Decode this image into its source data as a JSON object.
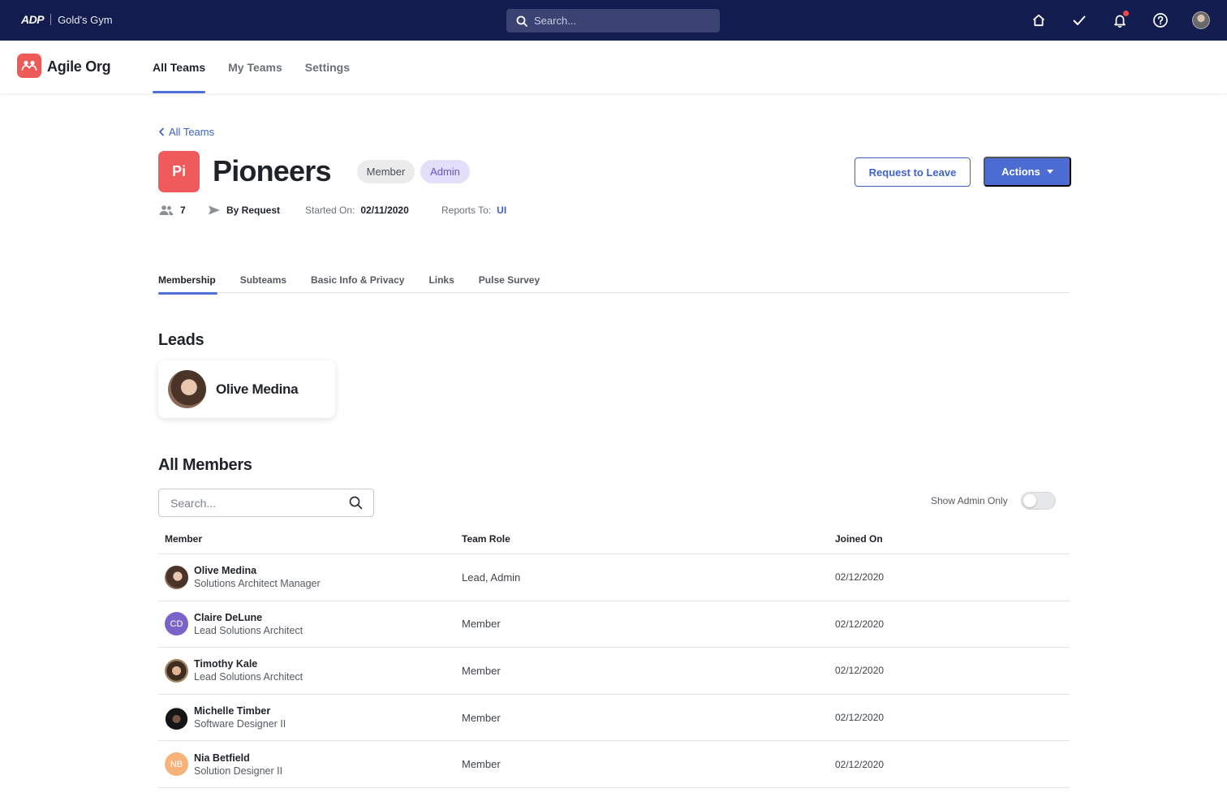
{
  "topbar": {
    "logo_text": "ADP",
    "company": "Gold's Gym",
    "search_placeholder": "Search...",
    "icons": [
      "home-icon",
      "check-icon",
      "bell-icon",
      "help-icon",
      "user-avatar"
    ]
  },
  "app": {
    "title": "Agile Org",
    "nav": [
      "All Teams",
      "My Teams",
      "Settings"
    ],
    "active_nav": "All Teams"
  },
  "team": {
    "breadcrumb": "All Teams",
    "initials": "Pi",
    "name": "Pioneers",
    "chips": [
      "Member",
      "Admin"
    ],
    "buttons": {
      "leave": "Request to Leave",
      "actions": "Actions"
    },
    "member_count": "7",
    "join_policy": "By Request",
    "started_label": "Started On:",
    "started_value": "02/11/2020",
    "reports_label": "Reports To:",
    "reports_value": "UI"
  },
  "tabs": [
    "Membership",
    "Subteams",
    "Basic Info & Privacy",
    "Links",
    "Pulse Survey"
  ],
  "active_tab": "Membership",
  "leads": {
    "heading": "Leads",
    "items": [
      {
        "name": "Olive Medina"
      }
    ]
  },
  "members": {
    "heading": "All Members",
    "search_placeholder": "Search...",
    "toggle_label": "Show Admin Only",
    "toggle_on": false,
    "columns": [
      "Member",
      "Team Role",
      "Joined On"
    ],
    "rows": [
      {
        "name": "Olive Medina",
        "title": "Solutions Architect Manager",
        "role": "Lead, Admin",
        "joined": "02/12/2020",
        "initials": ""
      },
      {
        "name": "Claire DeLune",
        "title": "Lead Solutions Architect",
        "role": "Member",
        "joined": "02/12/2020",
        "initials": "CD"
      },
      {
        "name": "Timothy Kale",
        "title": "Lead Solutions Architect",
        "role": "Member",
        "joined": "02/12/2020",
        "initials": ""
      },
      {
        "name": "Michelle Timber",
        "title": "Software Designer II",
        "role": "Member",
        "joined": "02/12/2020",
        "initials": ""
      },
      {
        "name": "Nia Betfield",
        "title": "Solution Designer II",
        "role": "Member",
        "joined": "02/12/2020",
        "initials": "NB"
      }
    ]
  },
  "colors": {
    "topbar": "#121c4e",
    "accent": "#4a6cd3",
    "team_badge": "#ef5b5b",
    "admin_chip": "#e3defa"
  }
}
